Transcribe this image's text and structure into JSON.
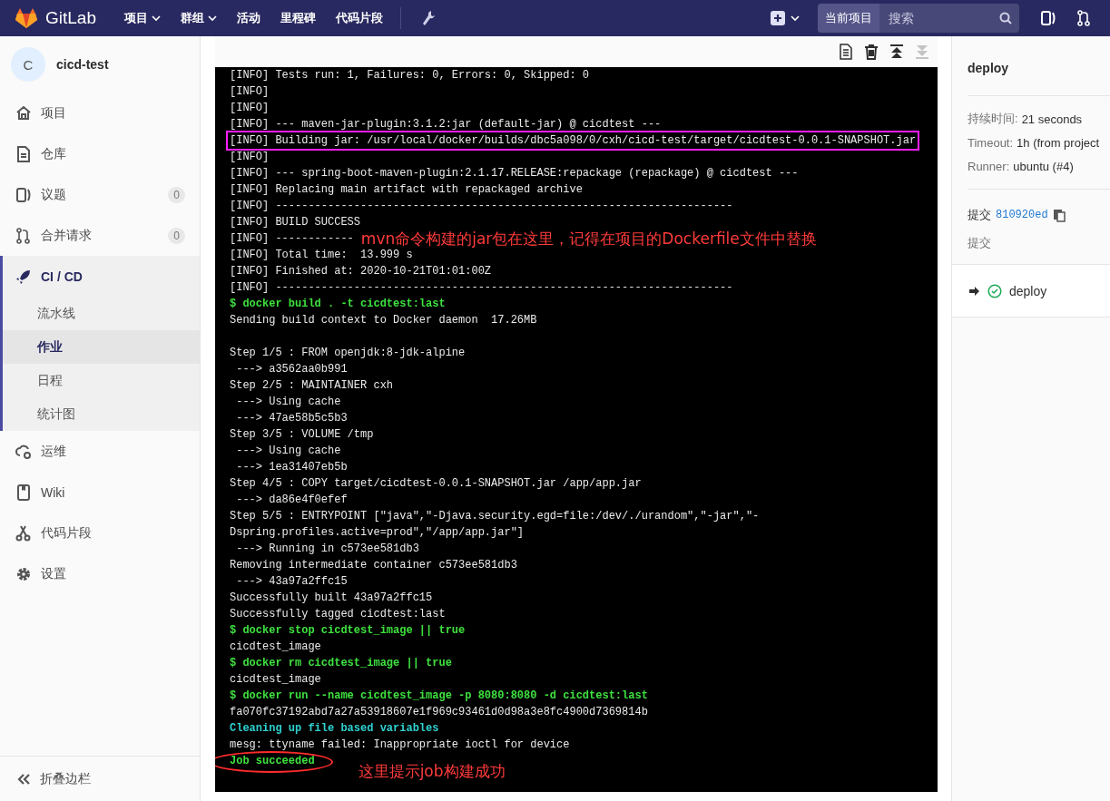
{
  "navbar": {
    "brand": "GitLab",
    "menu": [
      {
        "label": "项目",
        "dropdown": true
      },
      {
        "label": "群组",
        "dropdown": true
      },
      {
        "label": "活动",
        "dropdown": false
      },
      {
        "label": "里程碑",
        "dropdown": false
      },
      {
        "label": "代码片段",
        "dropdown": false
      }
    ],
    "scope": "当前项目",
    "search": {
      "placeholder": "搜索"
    }
  },
  "sidebar": {
    "project": {
      "avatar": "C",
      "name": "cicd-test"
    },
    "items": [
      {
        "kind": "home",
        "label": "项目",
        "selected": false
      },
      {
        "kind": "file",
        "label": "仓库",
        "selected": false
      },
      {
        "kind": "issues",
        "label": "议题",
        "count": "0",
        "selected": false
      },
      {
        "kind": "merge",
        "label": "合并请求",
        "count": "0",
        "selected": false
      },
      {
        "kind": "rocket",
        "label": "CI / CD",
        "selected": true,
        "children": [
          {
            "label": "流水线",
            "selected": false
          },
          {
            "label": "作业",
            "selected": true
          },
          {
            "label": "日程",
            "selected": false
          },
          {
            "label": "统计图",
            "selected": false
          }
        ]
      },
      {
        "kind": "cloud",
        "label": "运维",
        "selected": false
      },
      {
        "kind": "book",
        "label": "Wiki",
        "selected": false
      },
      {
        "kind": "scissors",
        "label": "代码片段",
        "selected": false
      },
      {
        "kind": "gear",
        "label": "设置",
        "selected": false
      }
    ],
    "collapse": "折叠边栏"
  },
  "toolbar": [
    {
      "kind": "raw",
      "disabled": false
    },
    {
      "kind": "erase",
      "disabled": false
    },
    {
      "kind": "top",
      "disabled": false
    },
    {
      "kind": "bottom",
      "disabled": true
    }
  ],
  "log": {
    "lines": [
      {
        "kind": "out",
        "text": "[INFO] Tests run: 1, Failures: 0, Errors: 0, Skipped: 0"
      },
      {
        "kind": "out",
        "text": "[INFO]"
      },
      {
        "kind": "out",
        "text": "[INFO]"
      },
      {
        "kind": "out",
        "text": "[INFO] --- maven-jar-plugin:3.1.2:jar (default-jar) @ cicdtest ---"
      },
      {
        "kind": "box",
        "lines": [
          {
            "kind": "out",
            "text": "[INFO] Building jar: /usr/local/docker/builds/dbc5a098/0/cxh/cicd-test/target/cicdtest-0.0.1-SNAPSHOT.jar"
          }
        ]
      },
      {
        "kind": "out",
        "text": "[INFO]"
      },
      {
        "kind": "out",
        "text": "[INFO] --- spring-boot-maven-plugin:2.1.17.RELEASE:repackage (repackage) @ cicdtest ---"
      },
      {
        "kind": "out",
        "text": "[INFO] Replacing main artifact with repackaged archive"
      },
      {
        "kind": "out",
        "text": "[INFO] ----------------------------------------------------------------------"
      },
      {
        "kind": "out",
        "text": "[INFO] BUILD SUCCESS"
      },
      {
        "kind": "out",
        "text": "[INFO] ------------",
        "note": "mvn命令构建的jar包在这里，记得在项目的Dockerfile文件中替换"
      },
      {
        "kind": "out",
        "text": "[INFO] Total time:  13.999 s"
      },
      {
        "kind": "out",
        "text": "[INFO] Finished at: 2020-10-21T01:01:00Z"
      },
      {
        "kind": "out",
        "text": "[INFO] ----------------------------------------------------------------------"
      },
      {
        "kind": "cmd",
        "text": "$ docker build . -t cicdtest:last"
      },
      {
        "kind": "out",
        "text": "Sending build context to Docker daemon  17.26MB"
      },
      {
        "kind": "blank"
      },
      {
        "kind": "out",
        "text": "Step 1/5 : FROM openjdk:8-jdk-alpine"
      },
      {
        "kind": "out",
        "text": " ---> a3562aa0b991"
      },
      {
        "kind": "out",
        "text": "Step 2/5 : MAINTAINER cxh"
      },
      {
        "kind": "out",
        "text": " ---> Using cache"
      },
      {
        "kind": "out",
        "text": " ---> 47ae58b5c5b3"
      },
      {
        "kind": "out",
        "text": "Step 3/5 : VOLUME /tmp"
      },
      {
        "kind": "out",
        "text": " ---> Using cache"
      },
      {
        "kind": "out",
        "text": " ---> 1ea31407eb5b"
      },
      {
        "kind": "out",
        "text": "Step 4/5 : COPY target/cicdtest-0.0.1-SNAPSHOT.jar /app/app.jar"
      },
      {
        "kind": "out",
        "text": " ---> da86e4f0efef"
      },
      {
        "kind": "out",
        "text": "Step 5/5 : ENTRYPOINT [\"java\",\"-Djava.security.egd=file:/dev/./urandom\",\"-jar\",\"-"
      },
      {
        "kind": "out",
        "text": "Dspring.profiles.active=prod\",\"/app/app.jar\"]"
      },
      {
        "kind": "out",
        "text": " ---> Running in c573ee581db3"
      },
      {
        "kind": "out",
        "text": "Removing intermediate container c573ee581db3"
      },
      {
        "kind": "out",
        "text": " ---> 43a97a2ffc15"
      },
      {
        "kind": "out",
        "text": "Successfully built 43a97a2ffc15"
      },
      {
        "kind": "out",
        "text": "Successfully tagged cicdtest:last"
      },
      {
        "kind": "cmd",
        "text": "$ docker stop cicdtest_image || true"
      },
      {
        "kind": "out",
        "text": "cicdtest_image"
      },
      {
        "kind": "cmd",
        "text": "$ docker rm cicdtest_image || true"
      },
      {
        "kind": "out",
        "text": "cicdtest_image"
      },
      {
        "kind": "cmd",
        "text": "$ docker run --name cicdtest_image -p 8080:8080 -d cicdtest:last"
      },
      {
        "kind": "out",
        "text": "fa070fc37192abd7a27a53918607e1f969c93461d0d98a3e8fc4900d7369814b"
      },
      {
        "kind": "section",
        "text": "Cleaning up file based variables"
      },
      {
        "kind": "out",
        "text": "mesg: ttyname failed: Inappropriate ioctl for device"
      },
      {
        "kind": "ellipse",
        "lines": [
          {
            "kind": "cmd",
            "text": "Job succeeded"
          }
        ],
        "note": "这里提示job构建成功"
      }
    ]
  },
  "details": {
    "title": "deploy",
    "info": [
      {
        "label": "持续时间:",
        "value": "21 seconds"
      },
      {
        "label": "Timeout:",
        "value": "1h (from project"
      },
      {
        "label": "Runner:",
        "value": "ubuntu (#4)"
      }
    ],
    "commit": {
      "label": "提交",
      "sha": "810920ed"
    },
    "commit_title": "提交",
    "jobs": [
      {
        "name": "deploy",
        "kind": "success",
        "current": true
      }
    ]
  }
}
